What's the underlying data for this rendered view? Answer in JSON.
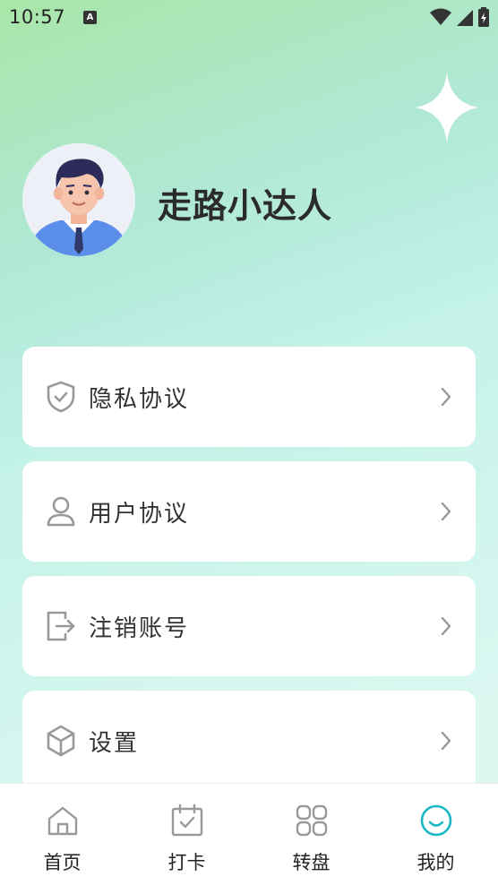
{
  "status_bar": {
    "time": "10:57",
    "indicator": "A"
  },
  "profile": {
    "username": "走路小达人",
    "avatar": "man-avatar-icon"
  },
  "menu": [
    {
      "label": "隐私协议",
      "icon": "shield-check-icon"
    },
    {
      "label": "用户协议",
      "icon": "user-icon"
    },
    {
      "label": "注销账号",
      "icon": "logout-icon"
    },
    {
      "label": "设置",
      "icon": "cube-icon"
    }
  ],
  "nav": [
    {
      "label": "首页",
      "icon": "home-icon",
      "active": false
    },
    {
      "label": "打卡",
      "icon": "calendar-check-icon",
      "active": false
    },
    {
      "label": "转盘",
      "icon": "grid-icon",
      "active": false
    },
    {
      "label": "我的",
      "icon": "smile-icon",
      "active": true
    }
  ],
  "colors": {
    "accent": "#1bb8c4",
    "icon_gray": "#999999",
    "text": "#333333"
  }
}
